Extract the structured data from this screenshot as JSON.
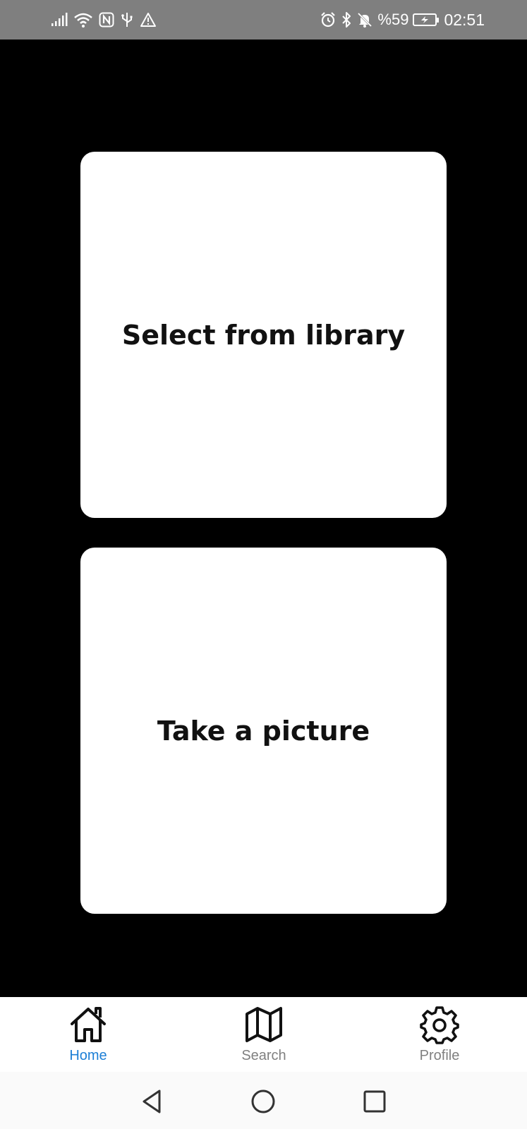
{
  "status_bar": {
    "battery_percent": "%59",
    "battery_level": 0.59,
    "clock": "02:51",
    "icons": [
      "signal-icon",
      "wifi-icon",
      "nfc-icon",
      "usb-icon",
      "warning-icon",
      "alarm-icon",
      "bluetooth-icon",
      "mute-icon",
      "battery-icon"
    ]
  },
  "main": {
    "select_from_library_label": "Select from library",
    "take_picture_label": "Take a picture"
  },
  "bottom_nav": {
    "active_color": "#1d7fd6",
    "inactive_color": "#808080",
    "items": [
      {
        "label": "Home",
        "icon": "home-icon",
        "active": true
      },
      {
        "label": "Search",
        "icon": "map-icon",
        "active": false
      },
      {
        "label": "Profile",
        "icon": "gear-icon",
        "active": false
      }
    ]
  },
  "system_nav": {
    "icons": [
      "back-icon",
      "home-circle-icon",
      "recents-icon"
    ]
  }
}
